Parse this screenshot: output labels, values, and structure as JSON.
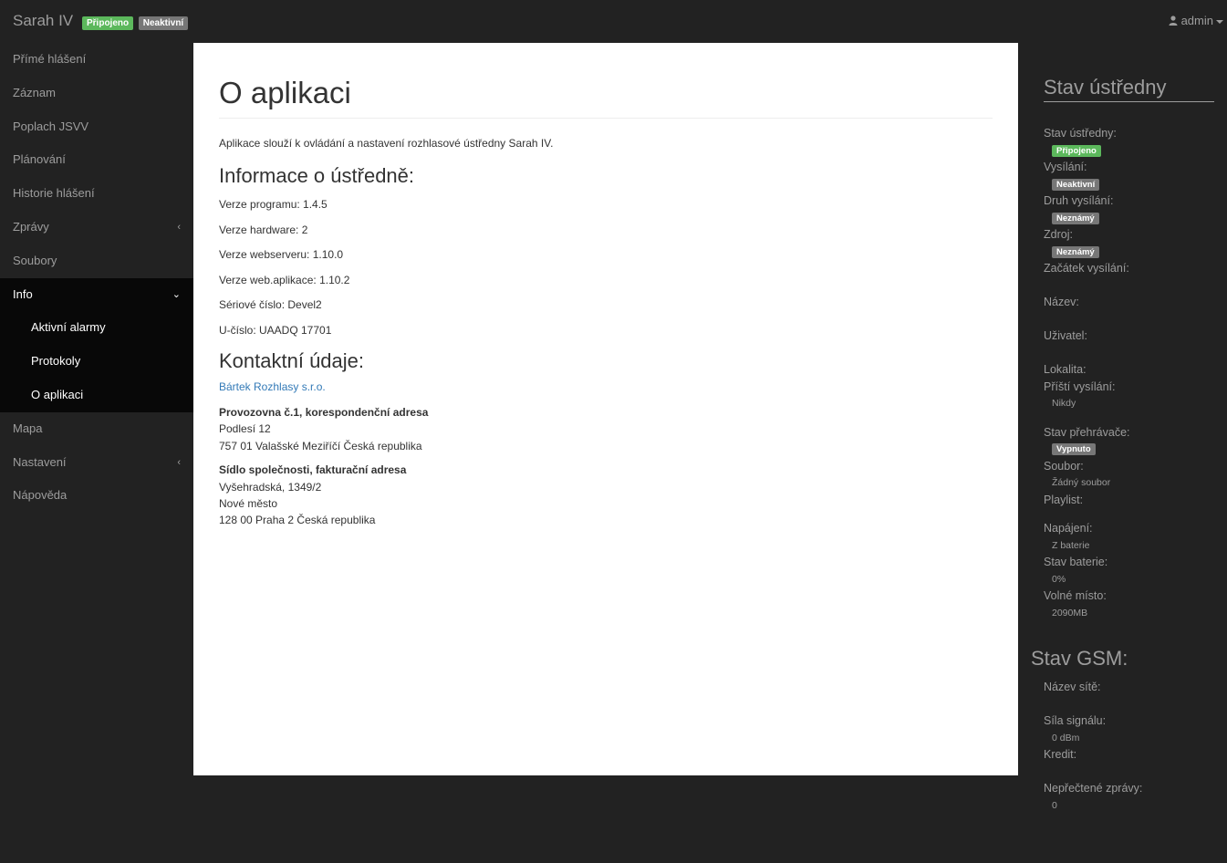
{
  "navbar": {
    "brand": "Sarah IV",
    "badge_connected": "Připojeno",
    "badge_inactive": "Neaktivní",
    "user": "admin"
  },
  "sidebar": {
    "items": [
      {
        "label": "Přímé hlášení"
      },
      {
        "label": "Záznam"
      },
      {
        "label": "Poplach JSVV"
      },
      {
        "label": "Plánování"
      },
      {
        "label": "Historie hlášení"
      },
      {
        "label": "Zprávy",
        "chevron": "‹"
      },
      {
        "label": "Soubory"
      },
      {
        "label": "Info",
        "chevron": "⌄"
      },
      {
        "label": "Mapa"
      },
      {
        "label": "Nastavení",
        "chevron": "‹"
      },
      {
        "label": "Nápověda"
      }
    ],
    "info_sub": [
      {
        "label": "Aktivní alarmy"
      },
      {
        "label": "Protokoly"
      },
      {
        "label": "O aplikaci"
      }
    ]
  },
  "main": {
    "title": "O aplikaci",
    "intro": "Aplikace slouží k ovládání a nastavení rozhlasové ústředny Sarah IV.",
    "info_heading": "Informace o ústředně:",
    "info_lines": [
      "Verze programu: 1.4.5",
      "Verze hardware: 2",
      "Verze webserveru: 1.10.0",
      "Verze web.aplikace: 1.10.2",
      "Sériové číslo: Devel2",
      "U-číslo: UAADQ 17701"
    ],
    "contact_heading": "Kontaktní údaje:",
    "company_link": "Bártek Rozhlasy s.r.o.",
    "address1": {
      "title": "Provozovna č.1, korespondenční adresa",
      "line1": "Podlesí 12",
      "line2": "757 01 Valašské Meziříčí Česká republika"
    },
    "address2": {
      "title": "Sídlo společnosti, fakturační adresa",
      "line1": "Vyšehradská, 1349/2",
      "line2": "Nové město",
      "line3": "128 00 Praha 2 Česká republika"
    }
  },
  "status": {
    "title": "Stav ústředny",
    "stav_label": "Stav ústředny:",
    "stav_value": "Připojeno",
    "vysilani_label": "Vysílání:",
    "vysilani_value": "Neaktivní",
    "druh_label": "Druh vysílání:",
    "druh_value": "Neznámý",
    "zdroj_label": "Zdroj:",
    "zdroj_value": "Neznámý",
    "zacatek_label": "Začátek vysílání:",
    "nazev_label": "Název:",
    "uzivatel_label": "Uživatel:",
    "lokalita_label": "Lokalita:",
    "pristi_label": "Příští vysílání:",
    "pristi_value": "Nikdy",
    "prehravac_label": "Stav přehrávače:",
    "prehravac_value": "Vypnuto",
    "soubor_label": "Soubor:",
    "soubor_value": "Žádný soubor",
    "playlist_label": "Playlist:",
    "napajeni_label": "Napájení:",
    "napajeni_value": "Z baterie",
    "baterie_label": "Stav baterie:",
    "baterie_value": "0%",
    "volne_label": "Volné místo:",
    "volne_value": "2090MB"
  },
  "gsm": {
    "title": "Stav GSM:",
    "sit_label": "Název sítě:",
    "signal_label": "Síla signálu:",
    "signal_value": "0 dBm",
    "kredit_label": "Kredit:",
    "zpravy_label": "Nepřečtené zprávy:",
    "zpravy_value": "0"
  },
  "colors": {
    "background": "#222222",
    "active_menu": "#080808",
    "success": "#5cb85c",
    "default_badge": "#777777",
    "link": "#337ab7"
  }
}
